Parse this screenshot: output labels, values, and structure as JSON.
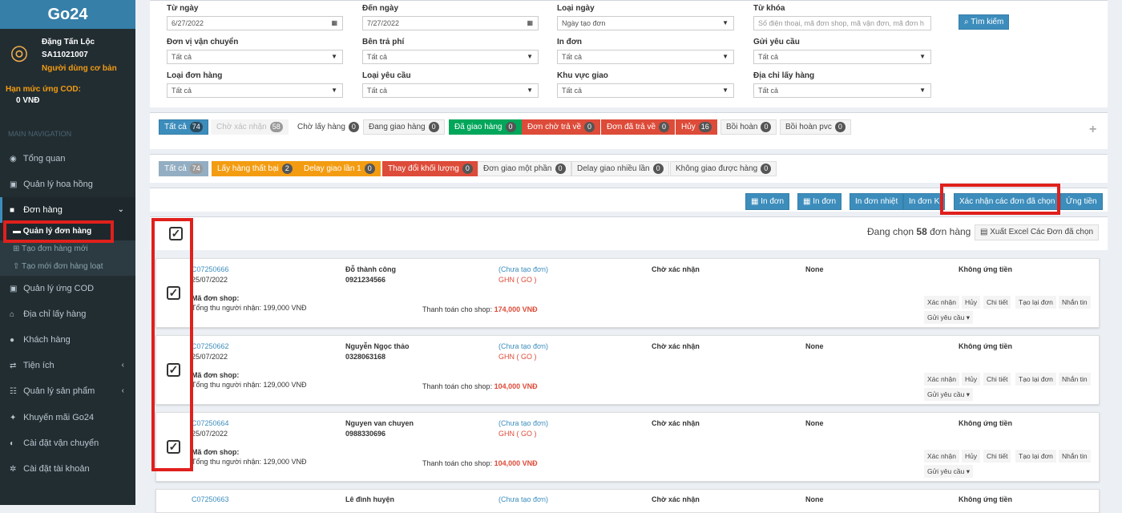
{
  "app": {
    "name": "Go24"
  },
  "user": {
    "name": "Đặng Tấn Lộc",
    "code": "SA11021007",
    "role": "Người dùng cơ bản"
  },
  "cod": {
    "label": "Hạn mức ứng COD:",
    "value": "0 VNĐ"
  },
  "sidebar": {
    "section": "MAIN NAVIGATION",
    "items": [
      {
        "label": "Tổng quan",
        "icon": "dashboard-icon"
      },
      {
        "label": "Quản lý hoa hồng",
        "icon": "money-icon"
      },
      {
        "label": "Đơn hàng",
        "icon": "briefcase-icon"
      },
      {
        "label": "Quản lý ứng COD",
        "icon": "money-icon"
      },
      {
        "label": "Địa chỉ lấy hàng",
        "icon": "bank-icon"
      },
      {
        "label": "Khách hàng",
        "icon": "user-icon"
      },
      {
        "label": "Tiện ích",
        "icon": "exchange-icon"
      },
      {
        "label": "Quản lý sản phẩm",
        "icon": "grid-icon"
      },
      {
        "label": "Khuyến mãi Go24",
        "icon": "gift-icon"
      },
      {
        "label": "Cài đặt vận chuyển",
        "icon": "toggle-icon"
      },
      {
        "label": "Cài đặt tài khoản",
        "icon": "gear-icon"
      }
    ],
    "subitems": [
      {
        "label": "Quản lý đơn hàng",
        "icon": "truck-icon"
      },
      {
        "label": "Tạo đơn hàng mới",
        "icon": "cart-icon"
      },
      {
        "label": "Tạo mới đơn hàng loạt",
        "icon": "upload-icon"
      }
    ]
  },
  "filters": {
    "from_date": {
      "label": "Từ ngày",
      "value": "6/27/2022"
    },
    "to_date": {
      "label": "Đến ngày",
      "value": "7/27/2022"
    },
    "date_type": {
      "label": "Loại ngày",
      "value": "Ngày tạo đơn"
    },
    "keyword": {
      "label": "Từ khóa",
      "placeholder": "Số điện thoại, mã đơn shop, mã vận đơn, mã đơn h"
    },
    "search_button": "Tìm kiếm",
    "carrier": {
      "label": "Đơn vị vận chuyển",
      "value": "Tất cả"
    },
    "fee_payer": {
      "label": "Bên trả phí",
      "value": "Tất cả"
    },
    "print": {
      "label": "In đơn",
      "value": "Tất cả"
    },
    "send_request": {
      "label": "Gửi yêu cầu",
      "value": "Tất cả"
    },
    "order_type": {
      "label": "Loại đơn hàng",
      "value": "Tất cả"
    },
    "request_type": {
      "label": "Loại yêu cầu",
      "value": "Tất cả"
    },
    "region": {
      "label": "Khu vực giao",
      "value": "Tất cả"
    },
    "pickup_address": {
      "label": "Địa chỉ lấy hàng",
      "value": "Tất cả"
    }
  },
  "status_tabs": [
    {
      "label": "Tất cả",
      "count": "74"
    },
    {
      "label": "Chờ xác nhận",
      "count": "58"
    },
    {
      "label": "Chờ lấy hàng",
      "count": "0"
    },
    {
      "label": "Đang giao hàng",
      "count": "0"
    },
    {
      "label": "Đã giao hàng",
      "count": "0"
    },
    {
      "label": "Đơn chờ trả về",
      "count": "0"
    },
    {
      "label": "Đơn đã trả về",
      "count": "0"
    },
    {
      "label": "Hủy",
      "count": "16"
    },
    {
      "label": "Bồi hoàn",
      "count": "0"
    },
    {
      "label": "Bồi hoàn pvc",
      "count": "0"
    }
  ],
  "problem_tabs": [
    {
      "label": "Tất cả",
      "count": "74"
    },
    {
      "label": "Lấy hàng thất bại",
      "count": "2"
    },
    {
      "label": "Delay giao lần 1",
      "count": "0"
    },
    {
      "label": "Thay đổi khối lượng",
      "count": "0"
    },
    {
      "label": "Đơn giao một phần",
      "count": "0"
    },
    {
      "label": "Delay giao nhiều lần",
      "count": "0"
    },
    {
      "label": "Không giao được hàng",
      "count": "0"
    }
  ],
  "expand_symbol": "+",
  "actions": {
    "print1": "In đơn",
    "print2": "In đơn",
    "print_thermal": "In đơn nhiệt",
    "print_k": "In đơn K",
    "confirm_selected": "Xác nhận các đơn đã chọn",
    "advance": "Ứng tiền"
  },
  "selection": {
    "prefix": "Đang chọn",
    "count": "58",
    "suffix": "đơn hàng",
    "export_button": "Xuất Excel Các Đơn đã chọn"
  },
  "order_labels": {
    "shop_code": "Mã đơn shop:",
    "total_prefix": "Tổng thu người nhận:",
    "payment_prefix": "Thanh toán cho shop:",
    "btn_confirm": "Xác nhận",
    "btn_cancel": "Hủy",
    "btn_detail": "Chi tiết",
    "btn_recreate": "Tạo lại đơn",
    "btn_message": "Nhắn tin",
    "btn_request": "Gửi yêu cầu"
  },
  "orders": [
    {
      "id": "C07250666",
      "date": "25/07/2022",
      "name": "Đỗ thành công",
      "phone": "0921234566",
      "status_note": "(Chưa tạo đơn)",
      "carrier": "GHN ( GO )",
      "state": "Chờ xác nhận",
      "extra": "None",
      "advance": "Không ứng tiền",
      "total": "199,000 VNĐ",
      "payment": "174,000 VNĐ"
    },
    {
      "id": "C07250662",
      "date": "25/07/2022",
      "name": "Nguyễn Ngọc thảo",
      "phone": "0328063168",
      "status_note": "(Chưa tạo đơn)",
      "carrier": "GHN ( GO )",
      "state": "Chờ xác nhận",
      "extra": "None",
      "advance": "Không ứng tiền",
      "total": "129,000 VNĐ",
      "payment": "104,000 VNĐ"
    },
    {
      "id": "C07250664",
      "date": "25/07/2022",
      "name": "Nguyen van chuyen",
      "phone": "0988330696",
      "status_note": "(Chưa tạo đơn)",
      "carrier": "GHN ( GO )",
      "state": "Chờ xác nhận",
      "extra": "None",
      "advance": "Không ứng tiền",
      "total": "129,000 VNĐ",
      "payment": "104,000 VNĐ"
    },
    {
      "id": "C07250663",
      "name": "Lê đình huyện",
      "status_note": "(Chưa tạo đơn)",
      "state": "Chờ xác nhận",
      "extra": "None",
      "advance": "Không ứng tiền"
    }
  ]
}
